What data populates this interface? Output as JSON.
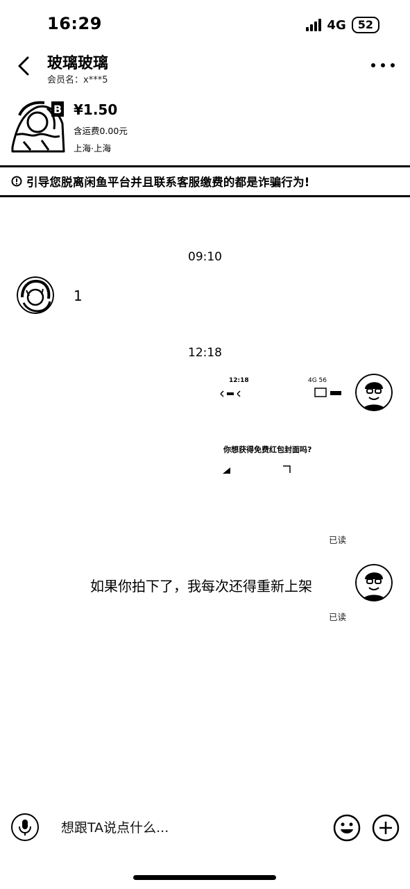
{
  "status_bar": {
    "time": "16:29",
    "network": "4G",
    "battery": "52"
  },
  "header": {
    "title": "玻璃玻璃",
    "member_label": "会员名：x***5"
  },
  "product": {
    "price": "¥1.50",
    "shipping": "含运费0.00元",
    "location": "上海·上海"
  },
  "warning": {
    "text": "引导您脱离闲鱼平台并且联系客服缴费的都是诈骗行为!"
  },
  "messages": {
    "time_1": "09:10",
    "msg_1_text": "1",
    "time_2": "12:18",
    "shot_time": "12:18",
    "shot_status": "4G 56",
    "shot_question": "你想获得免费红包封面吗?",
    "shot_read": "已读",
    "msg_3_text": "如果你拍下了，我每次还得重新上架",
    "msg_3_read": "已读"
  },
  "input_bar": {
    "placeholder": "想跟TA说点什么..."
  }
}
